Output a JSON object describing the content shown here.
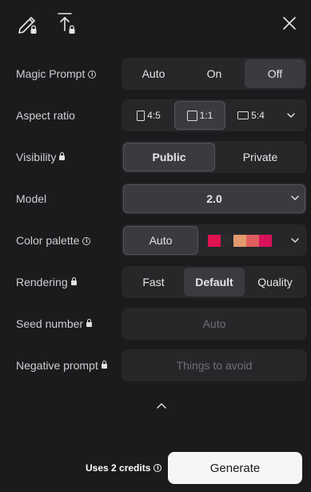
{
  "toolbar": {
    "edit_icon": "pencil-locked-icon",
    "upload_icon": "upload-locked-icon",
    "close_icon": "close-icon"
  },
  "magic_prompt": {
    "label": "Magic Prompt",
    "options": [
      "Auto",
      "On",
      "Off"
    ],
    "selected": "Off"
  },
  "aspect_ratio": {
    "label": "Aspect ratio",
    "options": [
      "4:5",
      "1:1",
      "5:4"
    ],
    "selected": "1:1"
  },
  "visibility": {
    "label": "Visibility",
    "options": [
      "Public",
      "Private"
    ],
    "selected": "Public"
  },
  "model": {
    "label": "Model",
    "value": "2.0"
  },
  "color_palette": {
    "label": "Color palette",
    "auto_label": "Auto",
    "swatches": [
      "#e0124f",
      "#2a2a2d",
      "#e09a6c",
      "#df5e5e",
      "#d8125a"
    ]
  },
  "rendering": {
    "label": "Rendering",
    "options": [
      "Fast",
      "Default",
      "Quality"
    ],
    "selected": "Default"
  },
  "seed": {
    "label": "Seed number",
    "placeholder": "Auto"
  },
  "negative_prompt": {
    "label": "Negative prompt",
    "placeholder": "Things to avoid"
  },
  "footer": {
    "credits": "Uses 2 credits",
    "generate_label": "Generate"
  },
  "colors": {
    "background": "#1b1b1d",
    "control_bg": "#27272a",
    "active_bg": "#3b3b3f",
    "button_bg": "#f6f6f6"
  }
}
